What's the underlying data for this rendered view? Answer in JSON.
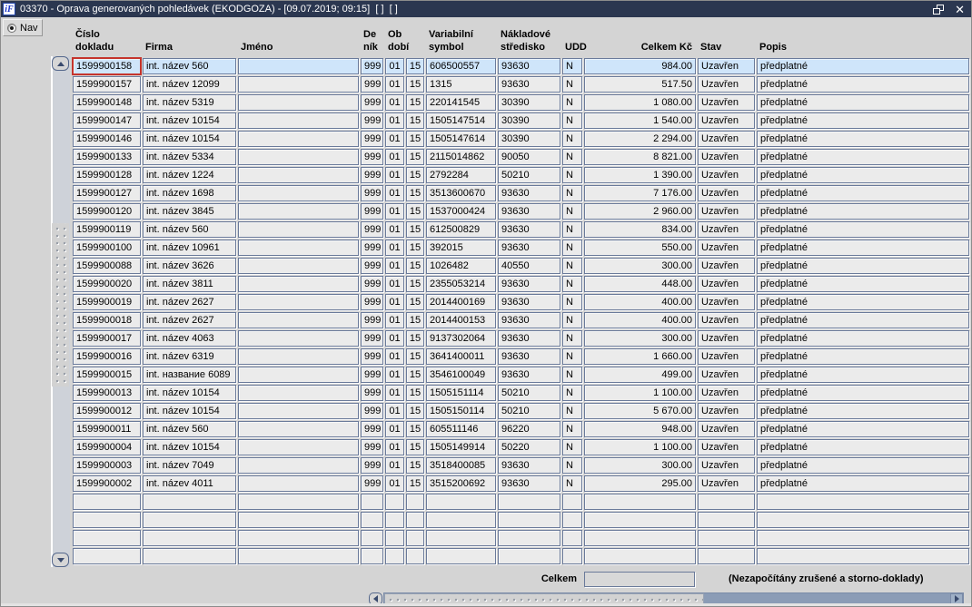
{
  "window": {
    "title": "03370 - Oprava generovaných pohledávek (EKODGOZA) - [09.07.2019; 09:15]  [ ]  [ ]",
    "logo_text": "iF"
  },
  "nav": {
    "label": "Nav",
    "selected": true
  },
  "colors": {
    "titlebar_bg": "#2b3750",
    "body_bg": "#d4d4d4",
    "cell_bg": "#ebebeb",
    "selected_row_bg": "#cfe5fa",
    "cell_border": "#6a7a9a",
    "focus_border": "#c5342c",
    "scroll_track": "#8b9cb6"
  },
  "table": {
    "columns": [
      {
        "id": "cislo-dokladu",
        "h1": "Číslo",
        "h2": "dokladu"
      },
      {
        "id": "firma",
        "h1": "",
        "h2": "Firma"
      },
      {
        "id": "jmeno",
        "h1": "",
        "h2": "Jméno"
      },
      {
        "id": "denik",
        "h1": "De",
        "h2": "ník"
      },
      {
        "id": "obdobi",
        "h1": "Ob",
        "h2": "dobí"
      },
      {
        "id": "obdobi2",
        "h1": "",
        "h2": ""
      },
      {
        "id": "variabilni-symbol",
        "h1": "Variabilní",
        "h2": "symbol"
      },
      {
        "id": "nakladove-stredisko",
        "h1": "Nákladové",
        "h2": "středisko"
      },
      {
        "id": "udd",
        "h1": "",
        "h2": "UDD"
      },
      {
        "id": "celkem-kc",
        "h1": "",
        "h2": "Celkem Kč"
      },
      {
        "id": "stav",
        "h1": "",
        "h2": "Stav"
      },
      {
        "id": "popis",
        "h1": "",
        "h2": "Popis"
      }
    ],
    "selected_row_index": 0,
    "focused_cell": {
      "row": 0,
      "col": 0
    },
    "empty_row_count": 4,
    "rows": [
      [
        "1599900158",
        "int. název 560",
        "",
        "999",
        "01",
        "15",
        "606500557",
        "93630",
        "N",
        "984.00",
        "Uzavřen",
        "předplatné"
      ],
      [
        "1599900157",
        "int. název 12099",
        "",
        "999",
        "01",
        "15",
        "1315",
        "93630",
        "N",
        "517.50",
        "Uzavřen",
        "předplatné"
      ],
      [
        "1599900148",
        "int. název 5319",
        "",
        "999",
        "01",
        "15",
        "220141545",
        "30390",
        "N",
        "1 080.00",
        "Uzavřen",
        "předplatné"
      ],
      [
        "1599900147",
        "int. název 10154",
        "",
        "999",
        "01",
        "15",
        "1505147514",
        "30390",
        "N",
        "1 540.00",
        "Uzavřen",
        "předplatné"
      ],
      [
        "1599900146",
        "int. název 10154",
        "",
        "999",
        "01",
        "15",
        "1505147614",
        "30390",
        "N",
        "2 294.00",
        "Uzavřen",
        "předplatné"
      ],
      [
        "1599900133",
        "int. název 5334",
        "",
        "999",
        "01",
        "15",
        "2115014862",
        "90050",
        "N",
        "8 821.00",
        "Uzavřen",
        "předplatné"
      ],
      [
        "1599900128",
        "int. název 1224",
        "",
        "999",
        "01",
        "15",
        "2792284",
        "50210",
        "N",
        "1 390.00",
        "Uzavřen",
        "předplatné"
      ],
      [
        "1599900127",
        "int. název 1698",
        "",
        "999",
        "01",
        "15",
        "3513600670",
        "93630",
        "N",
        "7 176.00",
        "Uzavřen",
        "předplatné"
      ],
      [
        "1599900120",
        "int. název 3845",
        "",
        "999",
        "01",
        "15",
        "1537000424",
        "93630",
        "N",
        "2 960.00",
        "Uzavřen",
        "předplatné"
      ],
      [
        "1599900119",
        "int. název 560",
        "",
        "999",
        "01",
        "15",
        "612500829",
        "93630",
        "N",
        "834.00",
        "Uzavřen",
        "předplatné"
      ],
      [
        "1599900100",
        "int. název 10961",
        "",
        "999",
        "01",
        "15",
        "392015",
        "93630",
        "N",
        "550.00",
        "Uzavřen",
        "předplatné"
      ],
      [
        "1599900088",
        "int. název 3626",
        "",
        "999",
        "01",
        "15",
        "1026482",
        "40550",
        "N",
        "300.00",
        "Uzavřen",
        "předplatné"
      ],
      [
        "1599900020",
        "int. název 3811",
        "",
        "999",
        "01",
        "15",
        "2355053214",
        "93630",
        "N",
        "448.00",
        "Uzavřen",
        "předplatné"
      ],
      [
        "1599900019",
        "int. název 2627",
        "",
        "999",
        "01",
        "15",
        "2014400169",
        "93630",
        "N",
        "400.00",
        "Uzavřen",
        "předplatné"
      ],
      [
        "1599900018",
        "int. název 2627",
        "",
        "999",
        "01",
        "15",
        "2014400153",
        "93630",
        "N",
        "400.00",
        "Uzavřen",
        "předplatné"
      ],
      [
        "1599900017",
        "int. název 4063",
        "",
        "999",
        "01",
        "15",
        "9137302064",
        "93630",
        "N",
        "300.00",
        "Uzavřen",
        "předplatné"
      ],
      [
        "1599900016",
        "int. název 6319",
        "",
        "999",
        "01",
        "15",
        "3641400011",
        "93630",
        "N",
        "1 660.00",
        "Uzavřen",
        "předplatné"
      ],
      [
        "1599900015",
        "int. название 6089",
        "",
        "999",
        "01",
        "15",
        "3546100049",
        "93630",
        "N",
        "499.00",
        "Uzavřen",
        "předplatné"
      ],
      [
        "1599900013",
        "int. název 10154",
        "",
        "999",
        "01",
        "15",
        "1505151114",
        "50210",
        "N",
        "1 100.00",
        "Uzavřen",
        "předplatné"
      ],
      [
        "1599900012",
        "int. název 10154",
        "",
        "999",
        "01",
        "15",
        "1505150114",
        "50210",
        "N",
        "5 670.00",
        "Uzavřen",
        "předplatné"
      ],
      [
        "1599900011",
        "int. název 560",
        "",
        "999",
        "01",
        "15",
        "605511146",
        "96220",
        "N",
        "948.00",
        "Uzavřen",
        "předplatné"
      ],
      [
        "1599900004",
        "int. název 10154",
        "",
        "999",
        "01",
        "15",
        "1505149914",
        "50220",
        "N",
        "1 100.00",
        "Uzavřen",
        "předplatné"
      ],
      [
        "1599900003",
        "int. název 7049",
        "",
        "999",
        "01",
        "15",
        "3518400085",
        "93630",
        "N",
        "300.00",
        "Uzavřen",
        "předplatné"
      ],
      [
        "1599900002",
        "int. název 4011",
        "",
        "999",
        "01",
        "15",
        "3515200692",
        "93630",
        "N",
        "295.00",
        "Uzavřen",
        "předplatné"
      ]
    ]
  },
  "footer": {
    "total_label": "Celkem",
    "total_value": "",
    "note": "(Nezapočítány zrušené a storno-doklady)"
  }
}
